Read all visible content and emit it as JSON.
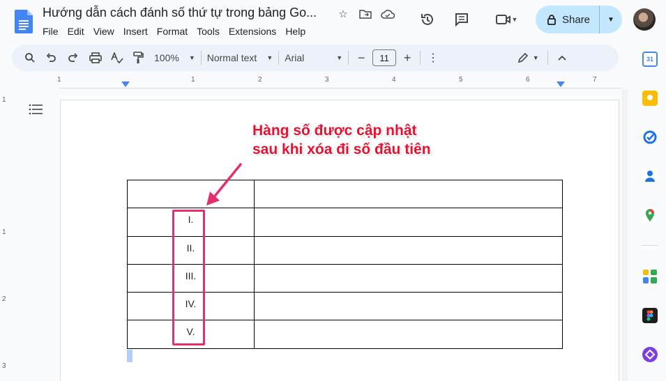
{
  "document": {
    "title": "Hướng dẫn cách đánh số thứ tự trong bảng Go..."
  },
  "menu": [
    "File",
    "Edit",
    "View",
    "Insert",
    "Format",
    "Tools",
    "Extensions",
    "Help"
  ],
  "header": {
    "share_label": "Share"
  },
  "toolbar": {
    "zoom": "100%",
    "style": "Normal text",
    "font": "Arial",
    "font_size": "11"
  },
  "ruler": {
    "h_labels": [
      "1",
      "1",
      "2",
      "3",
      "4",
      "5",
      "6",
      "7"
    ],
    "v_labels": [
      "1",
      "1",
      "2",
      "3"
    ]
  },
  "annotation": {
    "line1": "Hàng số được cập nhật",
    "line2": "sau khi xóa đi số đầu tiên"
  },
  "table": {
    "rows": [
      [
        "",
        ""
      ],
      [
        "I.",
        ""
      ],
      [
        "II.",
        ""
      ],
      [
        "III.",
        ""
      ],
      [
        "IV.",
        ""
      ],
      [
        "V.",
        ""
      ]
    ]
  },
  "colors": {
    "highlight": "#e62e6b",
    "annotation_text": "#e8102f",
    "share_bg": "#c2e7ff",
    "toolbar_bg": "#edf2fa"
  }
}
